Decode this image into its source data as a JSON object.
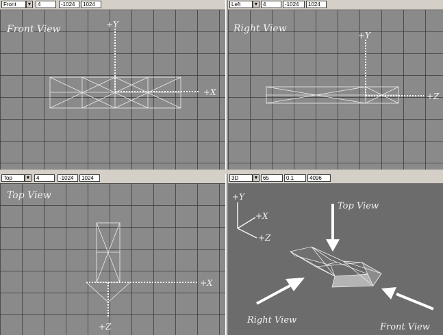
{
  "viewports": {
    "front": {
      "view": "Front",
      "grid": "4",
      "min": "-1024",
      "max": "1024",
      "title": "Front View",
      "axis_v": "+Y",
      "axis_h": "+X"
    },
    "left": {
      "view": "Left",
      "grid": "4",
      "min": "-1024",
      "max": "1024",
      "title": "Right View",
      "axis_v": "+Y",
      "axis_h": "+Z"
    },
    "top": {
      "view": "Top",
      "grid": "4",
      "min": "-1024",
      "max": "1024",
      "title": "Top View",
      "axis_v": "+Z",
      "axis_h": "+X"
    },
    "persp": {
      "view": "3D",
      "fov": "65",
      "near": "0.1",
      "far": "4096",
      "axis_y": "+Y",
      "axis_x": "+X",
      "axis_z": "+Z",
      "label_top": "Top View",
      "label_right": "Right View",
      "label_front": "Front View"
    }
  },
  "colors": {
    "grid_bg": "#8a8a8a",
    "persp_bg": "#6c6c6c",
    "wire": "#ffffff"
  }
}
